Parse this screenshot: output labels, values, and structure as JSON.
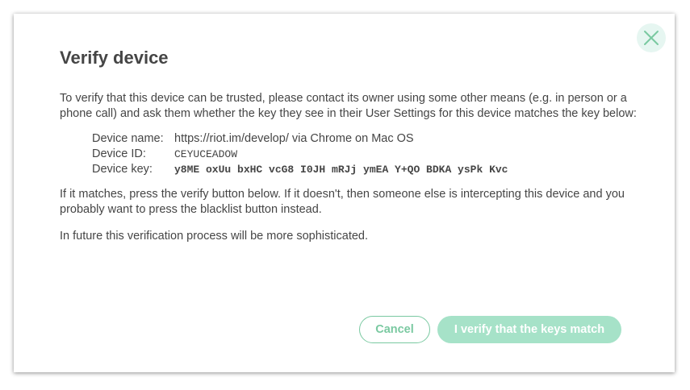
{
  "dialog": {
    "title": "Verify device",
    "intro": "To verify that this device can be trusted, please contact its owner using some other means (e.g. in person or a phone call) and ask them whether the key they see in their User Settings for this device matches the key below:",
    "device_name_label": "Device name:",
    "device_name_value": "https://riot.im/develop/ via Chrome on Mac OS",
    "device_id_label": "Device ID:",
    "device_id_value": "CEYUCEADOW",
    "device_key_label": "Device key:",
    "device_key_value": "y8ME oxUu bxHC vcG8 I0JH mRJj ymEA Y+QO BDKA ysPk Kvc",
    "match_text": "If it matches, press the verify button below. If it doesn't, then someone else is intercepting this device and you probably want to press the blacklist button instead.",
    "future_text": "In future this verification process will be more sophisticated.",
    "cancel_label": "Cancel",
    "verify_label": "I verify that the keys match",
    "close_icon": "close-icon"
  },
  "colors": {
    "accent": "#7ac9a1",
    "verify_button_bg": "#a6e2c8",
    "close_button_bg": "#e6f6f1",
    "text": "#454545"
  }
}
